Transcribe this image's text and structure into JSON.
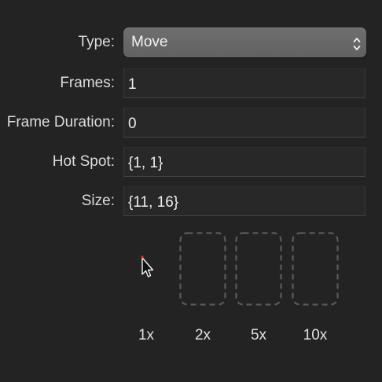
{
  "form": {
    "type": {
      "label": "Type:",
      "value": "Move"
    },
    "frames": {
      "label": "Frames:",
      "value": "1"
    },
    "frame_duration": {
      "label": "Frame Duration:",
      "value": "0"
    },
    "hot_spot": {
      "label": "Hot Spot:",
      "value": "{1, 1}"
    },
    "size": {
      "label": "Size:",
      "value": "{11, 16}"
    }
  },
  "previews": {
    "scales": [
      "1x",
      "2x",
      "5x",
      "10x"
    ]
  },
  "colors": {
    "background": "#232323",
    "hotspot_marker": "#e0302a",
    "placeholder_dash": "#5a5a5a"
  }
}
